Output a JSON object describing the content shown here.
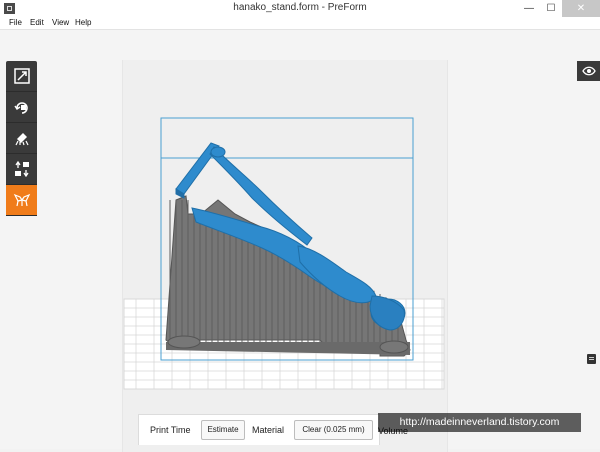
{
  "window": {
    "title": "hanako_stand.form - PreForm"
  },
  "menu": {
    "items": [
      "File",
      "Edit",
      "View",
      "Help"
    ]
  },
  "toolbar": {
    "tools": [
      {
        "name": "scale-tool",
        "icon": "scale-icon"
      },
      {
        "name": "rotate-tool",
        "icon": "rotate-icon"
      },
      {
        "name": "orient-tool",
        "icon": "orient-icon"
      },
      {
        "name": "layout-tool",
        "icon": "layout-icon"
      },
      {
        "name": "supports-tool",
        "icon": "supports-icon",
        "active": true
      }
    ],
    "active_color": "#f07c1a"
  },
  "bottom_bar": {
    "print_time_label": "Print Time",
    "estimate_button": "Estimate",
    "material_label": "Material",
    "material_button": "Clear (0.025 mm)",
    "volume_label": "Volume"
  },
  "watermark": "http://madeinneverland.tistory.com",
  "colors": {
    "model": "#2e8bcd",
    "supports": "#707070",
    "build_box": "#4a9fd1"
  }
}
